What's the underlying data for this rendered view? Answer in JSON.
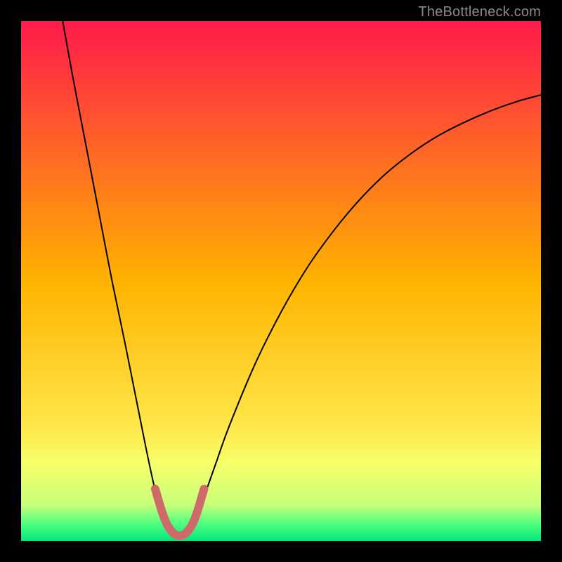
{
  "watermark": {
    "text": "TheBottleneck.com"
  },
  "chart_data": {
    "type": "line",
    "title": "",
    "xlabel": "",
    "ylabel": "",
    "xlim": [
      0,
      100
    ],
    "ylim": [
      0,
      100
    ],
    "grid": false,
    "legend": false,
    "background_gradient": {
      "stops": [
        {
          "offset": 0.0,
          "color": "#ff1a4b"
        },
        {
          "offset": 0.5,
          "color": "#ffb300"
        },
        {
          "offset": 0.78,
          "color": "#ffe74a"
        },
        {
          "offset": 0.85,
          "color": "#f7ff6a"
        },
        {
          "offset": 0.93,
          "color": "#c8ff7a"
        },
        {
          "offset": 0.965,
          "color": "#55ff80"
        },
        {
          "offset": 1.0,
          "color": "#00e87c"
        }
      ]
    },
    "series": [
      {
        "name": "curve",
        "note": "percent values estimated from image; y=0 is bottom, y=100 is top",
        "points": [
          {
            "x": 8.0,
            "y": 100.0
          },
          {
            "x": 10.0,
            "y": 89.0
          },
          {
            "x": 12.5,
            "y": 76.0
          },
          {
            "x": 15.0,
            "y": 63.0
          },
          {
            "x": 17.5,
            "y": 50.0
          },
          {
            "x": 20.0,
            "y": 38.0
          },
          {
            "x": 22.0,
            "y": 28.0
          },
          {
            "x": 24.0,
            "y": 18.0
          },
          {
            "x": 25.5,
            "y": 11.0
          },
          {
            "x": 27.0,
            "y": 5.0
          },
          {
            "x": 28.5,
            "y": 2.0
          },
          {
            "x": 30.0,
            "y": 1.0
          },
          {
            "x": 31.5,
            "y": 1.0
          },
          {
            "x": 33.0,
            "y": 3.0
          },
          {
            "x": 35.0,
            "y": 8.0
          },
          {
            "x": 37.5,
            "y": 15.0
          },
          {
            "x": 40.0,
            "y": 22.0
          },
          {
            "x": 45.0,
            "y": 34.0
          },
          {
            "x": 50.0,
            "y": 44.0
          },
          {
            "x": 55.0,
            "y": 52.5
          },
          {
            "x": 60.0,
            "y": 59.5
          },
          {
            "x": 65.0,
            "y": 65.5
          },
          {
            "x": 70.0,
            "y": 70.5
          },
          {
            "x": 75.0,
            "y": 74.5
          },
          {
            "x": 80.0,
            "y": 77.8
          },
          {
            "x": 85.0,
            "y": 80.4
          },
          {
            "x": 90.0,
            "y": 82.6
          },
          {
            "x": 95.0,
            "y": 84.4
          },
          {
            "x": 100.0,
            "y": 85.8
          }
        ]
      },
      {
        "name": "highlight-segment",
        "color": "#d06a6a",
        "points": [
          {
            "x": 25.8,
            "y": 10.0
          },
          {
            "x": 27.5,
            "y": 4.5
          },
          {
            "x": 29.0,
            "y": 1.8
          },
          {
            "x": 30.5,
            "y": 1.0
          },
          {
            "x": 32.0,
            "y": 1.8
          },
          {
            "x": 33.5,
            "y": 4.5
          },
          {
            "x": 35.2,
            "y": 10.0
          }
        ]
      }
    ]
  }
}
